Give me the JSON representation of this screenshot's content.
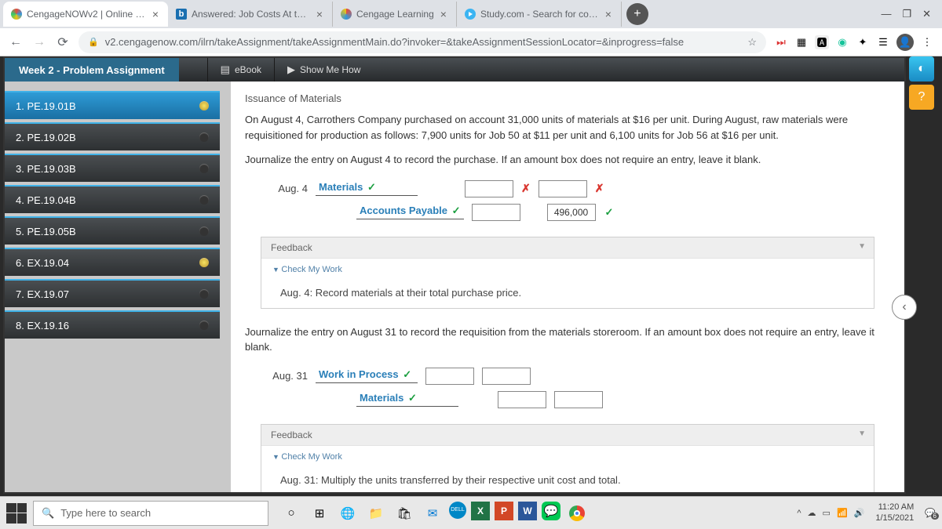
{
  "tabs": [
    {
      "label": "CengageNOWv2 | Online teachin",
      "active": true,
      "fav": "linear-gradient(45deg,#e74c3c,#3498db,#f1c40f)"
    },
    {
      "label": "Answered: Job Costs At the end",
      "active": false,
      "fav": "#1a6fb0",
      "prefix": "b"
    },
    {
      "label": "Cengage Learning",
      "active": false,
      "fav": "#fff"
    },
    {
      "label": "Study.com - Search for courses,",
      "active": false,
      "fav": "#3bb4f2"
    }
  ],
  "url": "v2.cengagenow.com/ilrn/takeAssignment/takeAssignmentMain.do?invoker=&takeAssignmentSessionLocator=&inprogress=false",
  "assignment_title": "Week 2 - Problem Assignment",
  "header_btns": {
    "ebook": "eBook",
    "show": "Show Me How"
  },
  "sidebar": [
    {
      "label": "1. PE.19.01B",
      "state": "active-prog"
    },
    {
      "label": "2. PE.19.02B",
      "state": ""
    },
    {
      "label": "3. PE.19.03B",
      "state": ""
    },
    {
      "label": "4. PE.19.04B",
      "state": ""
    },
    {
      "label": "5. PE.19.05B",
      "state": ""
    },
    {
      "label": "6. EX.19.04",
      "state": "prog"
    },
    {
      "label": "7. EX.19.07",
      "state": ""
    },
    {
      "label": "8. EX.19.16",
      "state": ""
    }
  ],
  "content": {
    "title": "Issuance of Materials",
    "p1": "On August 4, Carrothers Company purchased on account 31,000 units of materials at $16 per unit. During August, raw materials were requisitioned for production as follows: 7,900 units for Job 50 at $11 per unit and 6,100 units for Job 56 at $16 per unit.",
    "p2": "Journalize the entry on August 4 to record the purchase. If an amount box does not require an entry, leave it blank.",
    "entry1": {
      "date": "Aug. 4",
      "debit_acct": "Materials",
      "credit_acct": "Accounts Payable",
      "credit_amt": "496,000"
    },
    "fb_label": "Feedback",
    "cmw": "Check My Work",
    "fb1": "Aug. 4: Record materials at their total purchase price.",
    "p3": "Journalize the entry on August 31 to record the requisition from the materials storeroom. If an amount box does not require an entry, leave it blank.",
    "entry2": {
      "date": "Aug. 31",
      "debit_acct": "Work in Process",
      "credit_acct": "Materials"
    },
    "fb2": "Aug. 31: Multiply the units transferred by their respective unit cost and total."
  },
  "taskbar": {
    "search_placeholder": "Type here to search",
    "time": "11:20 AM",
    "date": "1/15/2021"
  }
}
